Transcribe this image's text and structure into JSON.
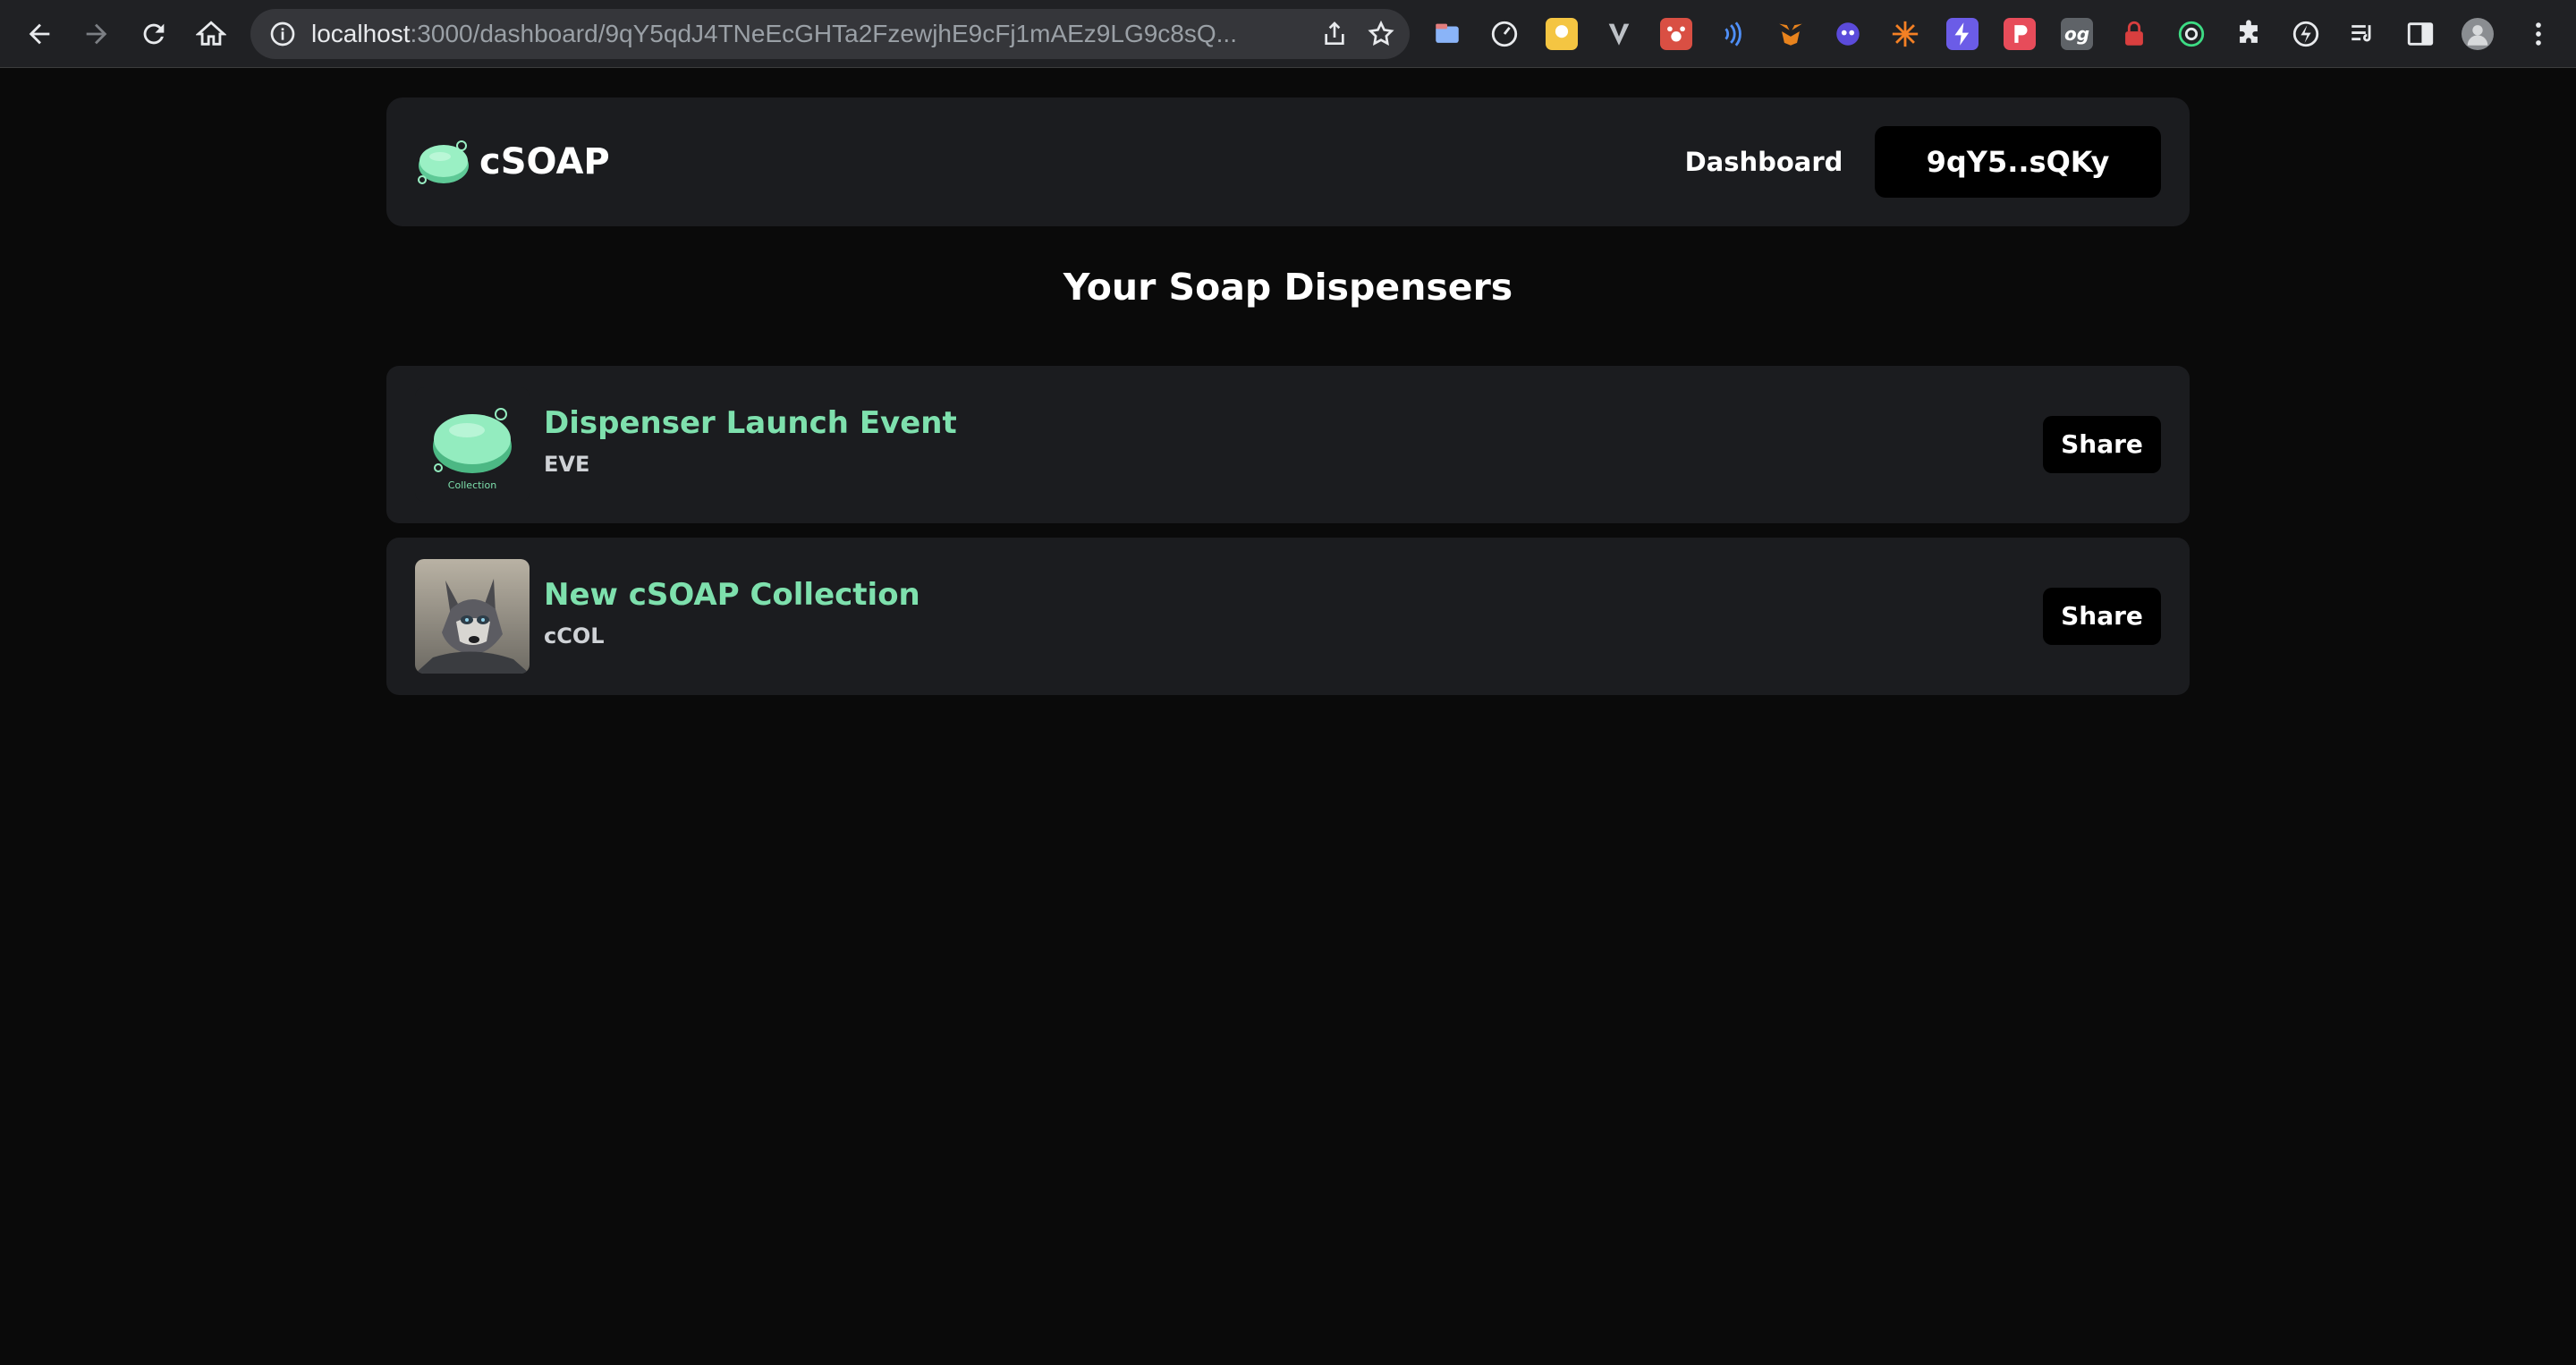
{
  "browser": {
    "url_host": "localhost",
    "url_rest": ":3000/dashboard/9qY5qdJ4TNeEcGHTa2FzewjhE9cFj1mAEz9LG9c8sQ..."
  },
  "app": {
    "brand": "cSOAP",
    "nav_dashboard": "Dashboard",
    "wallet_label": "9qY5..sQKy"
  },
  "page": {
    "title": "Your Soap Dispensers"
  },
  "dispensers": [
    {
      "name": "Dispenser Launch Event",
      "symbol": "EVE",
      "share_label": "Share",
      "thumb_caption": "Collection"
    },
    {
      "name": "New cSOAP Collection",
      "symbol": "cCOL",
      "share_label": "Share"
    }
  ],
  "colors": {
    "accent": "#7ee0ad",
    "card_bg": "#1b1c1f",
    "page_bg": "#0a0a0a"
  }
}
